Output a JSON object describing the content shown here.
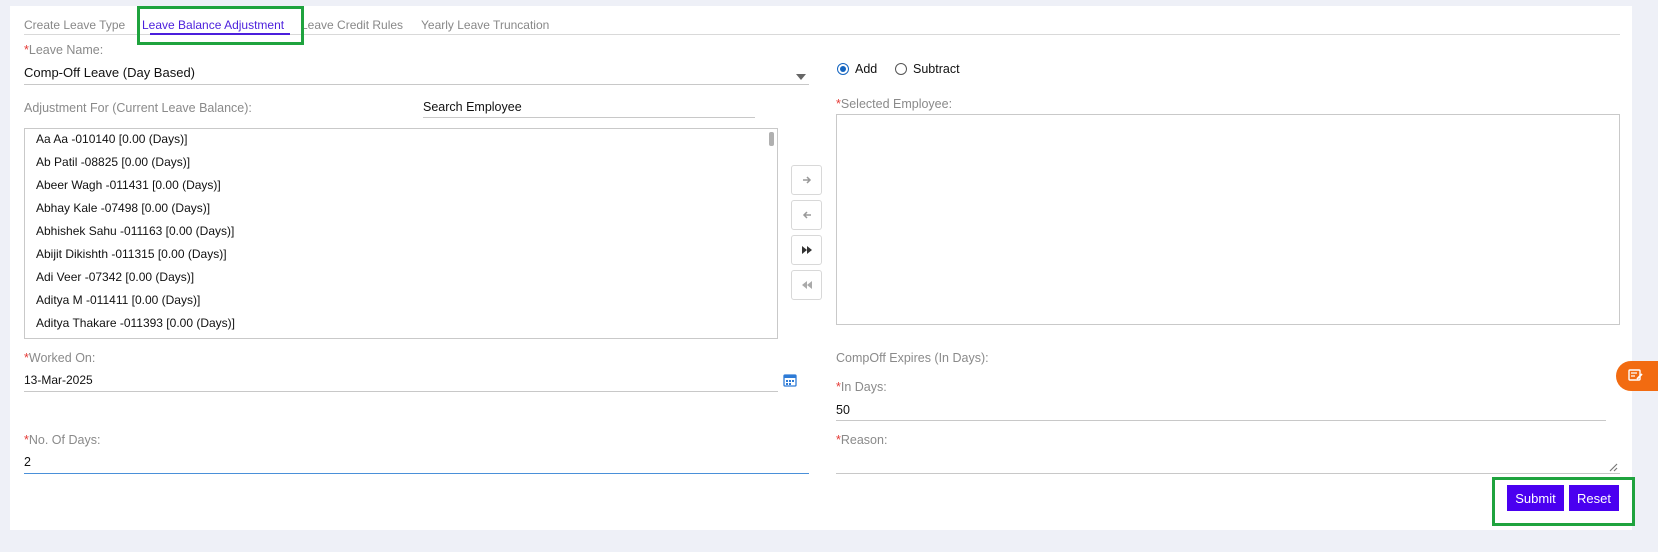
{
  "tabs": [
    "Create Leave Type",
    "Leave Balance Adjustment",
    "Leave Credit Rules",
    "Yearly Leave Truncation"
  ],
  "leave_name": {
    "label": "Leave Name:",
    "value": "Comp-Off Leave (Day Based)"
  },
  "operation": {
    "add_label": "Add",
    "subtract_label": "Subtract",
    "selected": "Add"
  },
  "adjustment_for_label": "Adjustment For (Current Leave Balance):",
  "search_employee": {
    "placeholder": "Search Employee"
  },
  "selected_employee_label": "Selected Employee:",
  "employees": [
    "Aa Aa -010140 [0.00 (Days)]",
    "Ab Patil -08825 [0.00 (Days)]",
    "Abeer Wagh -011431 [0.00 (Days)]",
    "Abhay Kale -07498 [0.00 (Days)]",
    "Abhishek Sahu -011163 [0.00 (Days)]",
    "Abijit Dikishth -011315 [0.00 (Days)]",
    "Adi Veer -07342 [0.00 (Days)]",
    "Aditya M -011411 [0.00 (Days)]",
    "Aditya Thakare -011393 [0.00 (Days)]"
  ],
  "worked_on": {
    "label": "Worked On:",
    "value": "13-Mar-2025"
  },
  "compoff_expires_label": "CompOff Expires (In Days):",
  "in_days": {
    "label": "In Days:",
    "value": "50"
  },
  "no_of_days": {
    "label": "No. Of Days:",
    "value": "2"
  },
  "reason": {
    "label": "Reason:",
    "value": ""
  },
  "required_mark": "*",
  "buttons": {
    "submit": "Submit",
    "reset": "Reset"
  },
  "icons": [
    "arrow-right-icon",
    "arrow-left-icon",
    "double-arrow-right-icon",
    "double-arrow-left-icon",
    "calendar-icon",
    "dropdown-caret-icon",
    "feedback-icon"
  ],
  "colors": {
    "accent": "#4b1fdc",
    "button": "#4a00f0",
    "highlight": "#1fa33e",
    "required": "#e53935",
    "fab": "#f26b11"
  }
}
